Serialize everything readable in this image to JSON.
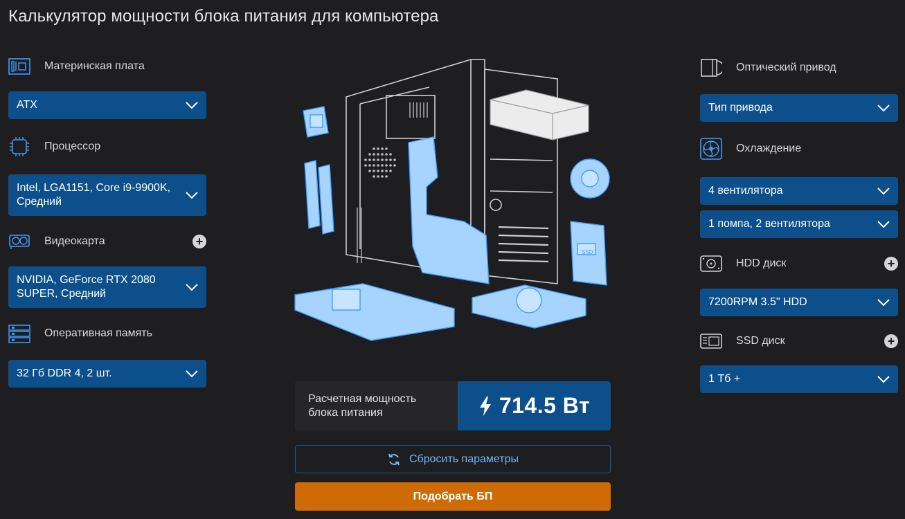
{
  "page": {
    "title": "Калькулятор мощности блока питания для компьютера"
  },
  "left": {
    "motherboard": {
      "label": "Материнская плата",
      "icon": "motherboard-icon",
      "value": "ATX"
    },
    "cpu": {
      "label": "Процессор",
      "icon": "cpu-icon",
      "value": "Intel, LGA1151, Core i9-9900K, Средний"
    },
    "gpu": {
      "label": "Видеокарта",
      "icon": "gpu-icon",
      "value": "NVIDIA, GeForce RTX 2080 SUPER, Средний",
      "add": "+"
    },
    "ram": {
      "label": "Оперативная память",
      "icon": "ram-icon",
      "value": "32 Гб DDR 4, 2 шт."
    }
  },
  "right": {
    "optical": {
      "label": "Оптический привод",
      "icon": "optical-drive-icon",
      "value": "Тип привода"
    },
    "cooling": {
      "label": "Охлаждение",
      "icon": "fan-icon",
      "value_fans": "4 вентилятора",
      "value_pump": "1 помпа, 2 вентилятора"
    },
    "hdd": {
      "label": "HDD диск",
      "icon": "hdd-icon",
      "value": "7200RPM 3.5\" HDD",
      "add": "+"
    },
    "ssd": {
      "label": "SSD диск",
      "icon": "ssd-icon",
      "value": "1 Тб +",
      "add": "+"
    }
  },
  "result": {
    "label": "Расчетная мощность блока питания",
    "value": "714.5 Вт"
  },
  "actions": {
    "reset_label": "Сбросить параметры",
    "pick_label": "Подобрать БП"
  },
  "colors": {
    "background": "#1e1e20",
    "select": "#0d4f8b",
    "accent_orange": "#cf6b06",
    "link_blue": "#6fb7ff",
    "illustration_blue": "#a6d4ff"
  }
}
